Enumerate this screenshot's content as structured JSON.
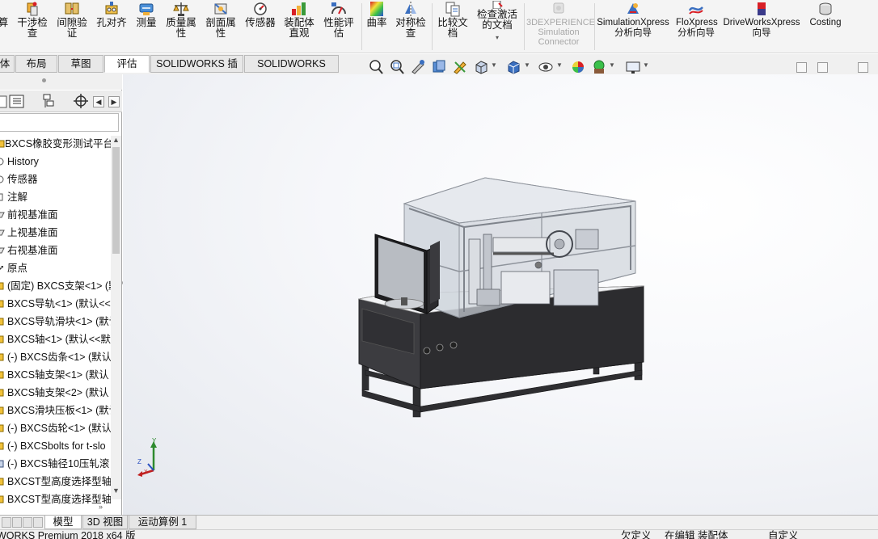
{
  "ribbon": {
    "items": [
      {
        "label": "算",
        "icon": "calculate-icon"
      },
      {
        "label": "干涉检查",
        "icon": "interference-check-icon"
      },
      {
        "label": "间隙验证",
        "icon": "clearance-verify-icon"
      },
      {
        "label": "孔对齐",
        "icon": "hole-alignment-icon"
      },
      {
        "label": "测量",
        "icon": "measure-icon"
      },
      {
        "label": "质量属性",
        "icon": "mass-properties-icon"
      },
      {
        "label": "剖面属性",
        "icon": "section-properties-icon"
      },
      {
        "label": "传感器",
        "icon": "sensor-icon"
      },
      {
        "label": "装配体直观",
        "icon": "assembly-visualization-icon"
      },
      {
        "label": "性能评估",
        "icon": "performance-evaluation-icon"
      },
      {
        "label": "曲率",
        "icon": "curvature-icon"
      },
      {
        "label": "对称检查",
        "icon": "symmetry-check-icon"
      },
      {
        "label": "比较文档",
        "icon": "compare-documents-icon"
      },
      {
        "label": "检查激活的文档",
        "icon": "check-active-document-icon"
      },
      {
        "label": "3DEXPERIENCE Simulation Connector",
        "icon": "3dexperience-icon"
      },
      {
        "label": "SimulationXpress 分析向导",
        "icon": "simulationxpress-icon"
      },
      {
        "label": "FloXpress 分析向导",
        "icon": "floxpress-icon"
      },
      {
        "label": "DriveWorksXpress 向导",
        "icon": "driveworksxpress-icon"
      },
      {
        "label": "Costing",
        "icon": "costing-icon"
      }
    ]
  },
  "tabs": {
    "items": [
      "体",
      "布局",
      "草图",
      "评估",
      "SOLIDWORKS 插件",
      "SOLIDWORKS MBD"
    ],
    "active": "评估"
  },
  "tree": {
    "root": "BXCS橡胶变形测试平台",
    "items": [
      "History",
      "传感器",
      "注解",
      "前视基准面",
      "上视基准面",
      "右视基准面",
      "原点",
      "(固定) BXCS支架<1> (默",
      "BXCS导轨<1> (默认<<",
      "BXCS导轨滑块<1> (默认",
      "BXCS轴<1> (默认<<默",
      "(-) BXCS齿条<1> (默认",
      "BXCS轴支架<1> (默认",
      "BXCS轴支架<2> (默认",
      "BXCS滑块压板<1> (默认",
      "(-) BXCS齿轮<1> (默认",
      "(-) BXCSbolts for t-slo",
      "(-) BXCS轴径10压轧滚",
      "BXCST型高度选择型轴",
      "BXCST型高度选择型轴"
    ]
  },
  "triad": {
    "x": "X",
    "y": "Y",
    "z": "Z"
  },
  "bottom_tabs": {
    "items": [
      "模型",
      "3D 视图",
      "运动算例 1"
    ],
    "active": "模型"
  },
  "status": {
    "product": "WORKS Premium 2018 x64 版",
    "mode": "欠定义",
    "editing": "在编辑 装配体",
    "custom": "自定义"
  },
  "colors": {
    "accent": "#d81f26",
    "panel_bg": "#f0f0f0",
    "active_tab": "#ffffff",
    "model_body": "#333336",
    "model_glass": "#d6dbe2",
    "model_frame": "#b2b5bc"
  }
}
